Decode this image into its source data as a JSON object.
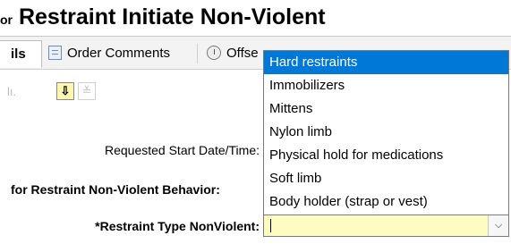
{
  "header": {
    "title_prefix": "or",
    "title": "Restraint Initiate Non-Violent"
  },
  "tabs": [
    {
      "label": "ils",
      "icon": null
    },
    {
      "label": "Order Comments",
      "icon": "document-list-icon"
    },
    {
      "label": "Offse",
      "icon": "clock-icon"
    }
  ],
  "toolbar": {
    "chart_icon": "bar-chart-icon",
    "down_button_glyph": "⇩",
    "disabled_button_glyph": "≚"
  },
  "form": {
    "start_label": "Requested Start Date/Time:",
    "behavior_label": "for Restraint Non-Violent Behavior:",
    "type_label": "*Restraint Type NonViolent:",
    "type_value": ""
  },
  "dropdown": {
    "options": [
      "Hard restraints",
      "Immobilizers",
      "Mittens",
      "Nylon limb",
      "Physical hold for medications",
      "Soft limb",
      "Body holder (strap or vest)"
    ],
    "highlighted_index": 0,
    "highlight_color": "#0078d7"
  },
  "colors": {
    "input_background": "#fffcc2",
    "tab_background": "#f3f3f3"
  }
}
